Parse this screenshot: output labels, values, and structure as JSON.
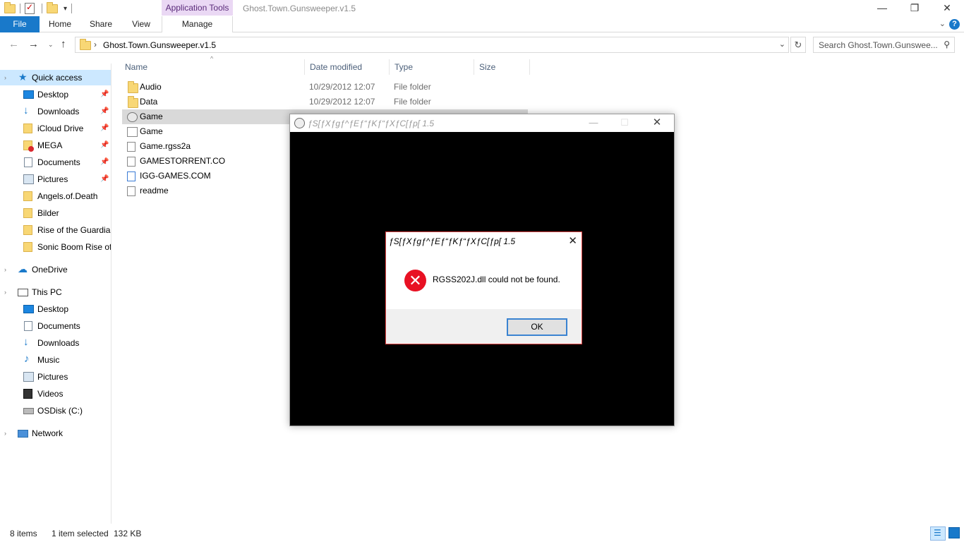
{
  "titlebar": {
    "context_tab": "Application Tools",
    "title": "Ghost.Town.Gunsweeper.v1.5",
    "minimize": "—",
    "restore": "❐",
    "close": "✕"
  },
  "ribbon": {
    "tabs": [
      {
        "label": "File"
      },
      {
        "label": "Home"
      },
      {
        "label": "Share"
      },
      {
        "label": "View"
      },
      {
        "label": "Manage"
      }
    ],
    "accent": "#1979ca"
  },
  "address": {
    "path": "Ghost.Town.Gunsweeper.v1.5",
    "search_placeholder": "Search Ghost.Town.Gunswee..."
  },
  "nav": {
    "items": [
      {
        "label": "Quick access",
        "icon": "star-icon"
      },
      {
        "label": "Desktop",
        "icon": "desktop-icon",
        "pinned": true
      },
      {
        "label": "Downloads",
        "icon": "download-icon",
        "pinned": true
      },
      {
        "label": "iCloud Drive",
        "icon": "folder-icon",
        "pinned": true
      },
      {
        "label": "MEGA",
        "icon": "mega-folder-icon",
        "pinned": true
      },
      {
        "label": "Documents",
        "icon": "documents-icon",
        "pinned": true
      },
      {
        "label": "Pictures",
        "icon": "pictures-icon",
        "pinned": true
      },
      {
        "label": "Angels.of.Death",
        "icon": "folder-icon"
      },
      {
        "label": "Bilder",
        "icon": "folder-icon"
      },
      {
        "label": "Rise of the Guardians",
        "icon": "folder-icon"
      },
      {
        "label": "Sonic Boom Rise of Lyric",
        "icon": "folder-icon"
      },
      {
        "label": "OneDrive",
        "icon": "onedrive-icon"
      },
      {
        "label": "This PC",
        "icon": "pc-icon"
      },
      {
        "label": "Desktop",
        "icon": "desktop-icon"
      },
      {
        "label": "Documents",
        "icon": "documents-icon"
      },
      {
        "label": "Downloads",
        "icon": "download-icon"
      },
      {
        "label": "Music",
        "icon": "music-icon"
      },
      {
        "label": "Pictures",
        "icon": "pictures-icon"
      },
      {
        "label": "Videos",
        "icon": "videos-icon"
      },
      {
        "label": "OSDisk (C:)",
        "icon": "disk-icon"
      },
      {
        "label": "Network",
        "icon": "network-icon"
      }
    ]
  },
  "files": {
    "columns": [
      "Name",
      "Date modified",
      "Type",
      "Size"
    ],
    "rows": [
      {
        "name": "Audio",
        "date": "10/29/2012 12:07",
        "type": "File folder",
        "icon": "folder-icon"
      },
      {
        "name": "Data",
        "date": "10/29/2012 12:07",
        "type": "File folder",
        "icon": "folder-icon"
      },
      {
        "name": "Game",
        "date": "",
        "type": "",
        "icon": "application-icon",
        "selected": true
      },
      {
        "name": "Game",
        "date": "",
        "type": "",
        "icon": "config-icon"
      },
      {
        "name": "Game.rgss2a",
        "date": "",
        "type": "",
        "icon": "file-icon"
      },
      {
        "name": "GAMESTORRENT.CO",
        "date": "",
        "type": "",
        "icon": "file-icon"
      },
      {
        "name": "IGG-GAMES.COM",
        "date": "",
        "type": "",
        "icon": "url-icon"
      },
      {
        "name": "readme",
        "date": "",
        "type": "",
        "icon": "text-file-icon"
      }
    ]
  },
  "status": {
    "items": "8 items",
    "selected": "1 item selected",
    "size": "132 KB"
  },
  "game_window": {
    "title": "ƒS[ƒXƒgƒ^ƒEƒ“ƒKƒ“ƒXƒC[ƒp[ 1.5",
    "minimize": "—",
    "maximize": "☐",
    "close": "✕"
  },
  "error_dialog": {
    "title": "ƒS[ƒXƒgƒ^ƒEƒ“ƒKƒ“ƒXƒC[ƒp[ 1.5",
    "close": "✕",
    "icon_glyph": "✕",
    "message": "RGSS202J.dll could not be found.",
    "ok_label": "OK",
    "error_color": "#e81123"
  }
}
